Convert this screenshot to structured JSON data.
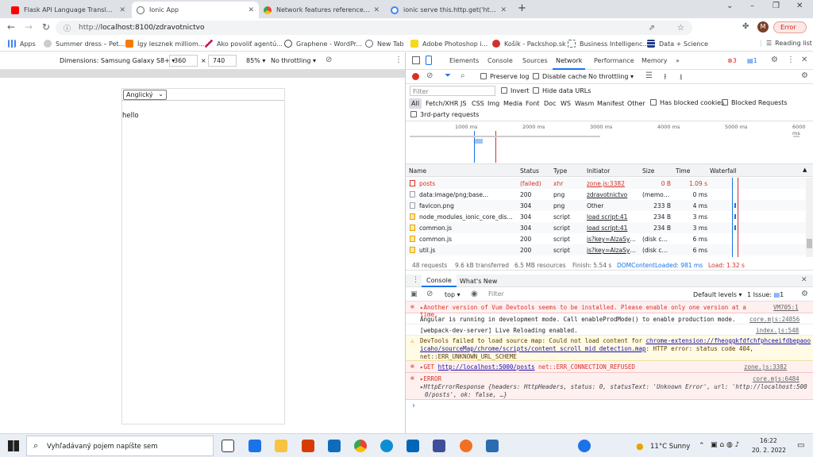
{
  "tabs": [
    {
      "title": "Flask API Language Translations",
      "icon": "youtube-icon",
      "color": "#ff0000"
    },
    {
      "title": "Ionic App",
      "icon": "globe-icon",
      "color": "#5f6368"
    },
    {
      "title": "Network features reference - Chr",
      "icon": "chrome-icon",
      "color": "#1a73e8"
    },
    {
      "title": "ionic serve this.http.get('http://lo",
      "icon": "google-icon",
      "color": "#4285f4"
    }
  ],
  "new_tab": "+",
  "window_controls": {
    "minimize": "⌄",
    "min2": "–",
    "restore": "❐",
    "close": "✕"
  },
  "url": "localhost:8100/zdravotnictvo",
  "url_prefix": "http://",
  "profile": "M",
  "error_badge": "Error",
  "bookmarks": [
    "Apps",
    "Summer dress – Pet...",
    "Így lesznek milliom...",
    "Ako povoliť agentú...",
    "Graphene - WordPr...",
    "New Tab",
    "Adobe Photoshop i...",
    "Košík - Packshop.sk",
    "Business Intelligenc...",
    "Data + Science"
  ],
  "reading_list": "Reading list",
  "device_bar": {
    "dimensions_label": "Dimensions: Samsung Galaxy S8+",
    "width": "360",
    "times": "×",
    "height": "740",
    "zoom": "85%",
    "throttle": "No throttling"
  },
  "app": {
    "select_value": "Anglický",
    "text": "hello"
  },
  "devtools": {
    "tabs": [
      "Elements",
      "Console",
      "Sources",
      "Network",
      "Performance",
      "Memory",
      "»"
    ],
    "error_count": "3",
    "msg_count": "1",
    "net_toolbar": {
      "preserve_log": "Preserve log",
      "disable_cache": "Disable cache",
      "throttle": "No throttling"
    },
    "filter_placeholder": "Filter",
    "invert": "Invert",
    "hide_data_urls": "Hide data URLs",
    "types": [
      "All",
      "Fetch/XHR",
      "JS",
      "CSS",
      "Img",
      "Media",
      "Font",
      "Doc",
      "WS",
      "Wasm",
      "Manifest",
      "Other"
    ],
    "has_blocked": "Has blocked cookies",
    "blocked_requests": "Blocked Requests",
    "third_party": "3rd-party requests",
    "timeline_ticks": [
      "1000 ms",
      "2000 ms",
      "3000 ms",
      "4000 ms",
      "5000 ms",
      "6000 ms"
    ],
    "columns": [
      "Name",
      "Status",
      "Type",
      "Initiator",
      "Size",
      "Time",
      "Waterfall"
    ],
    "rows": [
      {
        "name": "posts",
        "status": "(failed)",
        "type": "xhr",
        "initiator": "zone.js:3382",
        "size": "0 B",
        "time": "1.09 s",
        "failed": true
      },
      {
        "name": "data:image/png;base...",
        "status": "200",
        "type": "png",
        "initiator": "zdravotnictvo",
        "size": "(memor...",
        "time": "0 ms"
      },
      {
        "name": "favicon.png",
        "status": "304",
        "type": "png",
        "initiator": "Other",
        "size": "233 B",
        "time": "4 ms"
      },
      {
        "name": "node_modules_ionic_core_dist_e...",
        "status": "304",
        "type": "script",
        "initiator": "load script:41",
        "size": "234 B",
        "time": "3 ms"
      },
      {
        "name": "common.js",
        "status": "304",
        "type": "script",
        "initiator": "load script:41",
        "size": "234 B",
        "time": "3 ms"
      },
      {
        "name": "common.js",
        "status": "200",
        "type": "script",
        "initiator": "js?key=AlzaSyC...",
        "size": "(disk ca...",
        "time": "6 ms"
      },
      {
        "name": "util.js",
        "status": "200",
        "type": "script",
        "initiator": "js?key=AlzaSyC...",
        "size": "(disk ca...",
        "time": "6 ms"
      }
    ],
    "summary": {
      "requests": "48 requests",
      "transferred": "9.6 kB transferred",
      "resources": "6.5 MB resources",
      "finish": "Finish: 5.54 s",
      "dcl": "DOMContentLoaded: 981 ms",
      "load": "Load: 1.32 s"
    },
    "drawer_tabs": [
      "Console",
      "What's New"
    ],
    "console_context": "top",
    "console_filter": "Filter",
    "levels": "Default levels",
    "issues": "1 Issue:",
    "issues_count": "1",
    "messages": [
      {
        "kind": "error",
        "text": "▸Another version of Vue Devtools seems to be installed. Please enable only one version at a time.",
        "src": "VM705:1"
      },
      {
        "kind": "info",
        "text": "Angular is running in development mode. Call enableProdMode() to enable production mode.",
        "src": "core.mjs:24856"
      },
      {
        "kind": "info",
        "text": "[webpack-dev-server] Live Reloading enabled.",
        "src": "index.js:548"
      },
      {
        "kind": "warn",
        "text1": "DevTools failed to load source map: Could not load content for ",
        "link": "chrome-extension://fheoggkfdfchfphceeifdbepaoo",
        "link2": "icaho/sourceMap/chrome/scripts/content_scroll_mid_detection.map",
        "text2": ": HTTP error: status code 404,",
        "text3": "net::ERR_UNKNOWN_URL_SCHEME"
      },
      {
        "kind": "error",
        "pre": "▸GET ",
        "link": "http://localhost:5000/posts",
        "post": " net::ERR_CONNECTION_REFUSED",
        "src": "zone.js:3382"
      },
      {
        "kind": "error",
        "text": "▸ERROR",
        "src": "core.mjs:6484",
        "l2": "▸HttpErrorResponse {headers: HttpHeaders, status: 0, statusText: 'Unknown Error', url: 'http://localhost:500",
        "l3": "0/posts', ok: false, …}"
      }
    ],
    "prompt": "›"
  },
  "taskbar": {
    "search": "Vyhľadávaný pojem napíšte sem",
    "weather": "11°C  Sunny",
    "time": "16:22",
    "date": "20. 2. 2022"
  },
  "colors": {
    "accent": "#1a73e8",
    "error": "#d93025",
    "warn_bg": "#fffbe5",
    "error_bg": "#fff0f0"
  }
}
